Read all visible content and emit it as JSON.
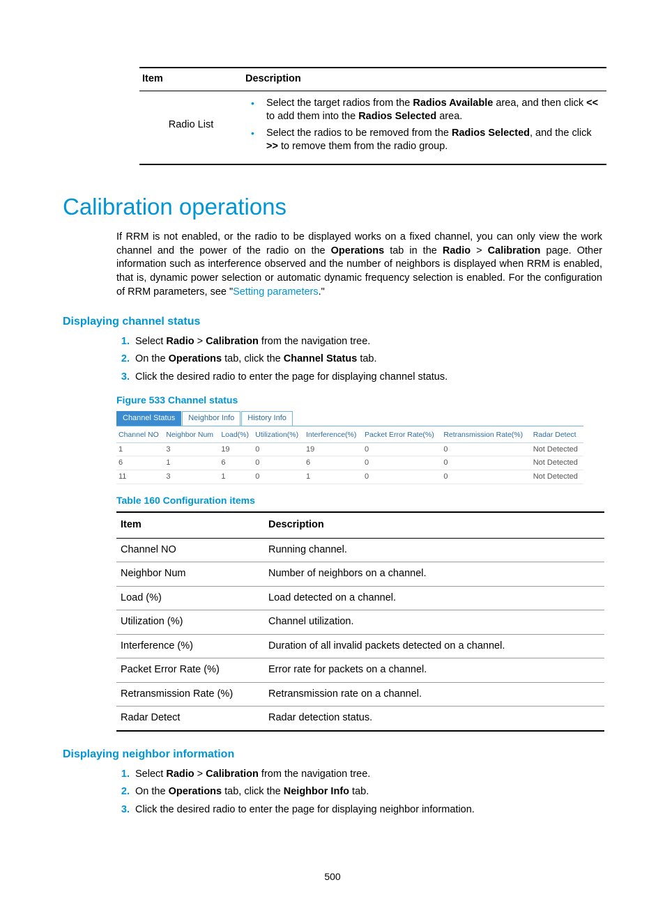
{
  "top_table": {
    "headers": {
      "item": "Item",
      "desc": "Description"
    },
    "row": {
      "item": "Radio List",
      "bullet1_pre": "Select the target radios from the ",
      "bullet1_b1": "Radios Available",
      "bullet1_mid": " area, and then click ",
      "bullet1_b2": "<<",
      "bullet1_post": " to add them into the ",
      "bullet1_b3": "Radios Selected",
      "bullet1_end": " area.",
      "bullet2_pre": "Select the radios to be removed from the ",
      "bullet2_b1": "Radios Selected",
      "bullet2_mid": ", and the click ",
      "bullet2_b2": ">>",
      "bullet2_post": " to remove them from the radio group."
    }
  },
  "section_title": "Calibration operations",
  "intro": {
    "p1a": "If RRM is not enabled, or the radio to be displayed works on a fixed channel, you can only view the work channel and the power of the radio on the ",
    "p1b": "Operations",
    "p1c": " tab in the ",
    "p1d": "Radio",
    "p1e": " > ",
    "p1f": "Calibration",
    "p1g": " page. Other information such as interference observed and the number of neighbors is displayed when RRM is enabled, that is, dynamic power selection or automatic dynamic frequency selection is enabled. For the configuration of RRM parameters, see \"",
    "p1h": "Setting parameters",
    "p1i": ".\""
  },
  "sub1": "Displaying channel status",
  "steps1": {
    "s1a": "Select ",
    "s1b": "Radio",
    "s1c": " > ",
    "s1d": "Calibration",
    "s1e": " from the navigation tree.",
    "s2a": "On the ",
    "s2b": "Operations",
    "s2c": " tab, click the ",
    "s2d": "Channel Status",
    "s2e": " tab.",
    "s3": "Click the desired radio to enter the page for displaying channel status."
  },
  "fig533_caption": "Figure 533 Channel status",
  "tabs": {
    "t1": "Channel Status",
    "t2": "Neighbor Info",
    "t3": "History Info"
  },
  "chart_data": {
    "type": "table",
    "columns": [
      "Channel NO",
      "Neighbor Num",
      "Load(%)",
      "Utilization(%)",
      "Interference(%)",
      "Packet Error Rate(%)",
      "Retransmission Rate(%)",
      "Radar Detect"
    ],
    "rows": [
      [
        "1",
        "3",
        "19",
        "0",
        "19",
        "0",
        "0",
        "Not Detected"
      ],
      [
        "6",
        "1",
        "6",
        "0",
        "6",
        "0",
        "0",
        "Not Detected"
      ],
      [
        "11",
        "3",
        "1",
        "0",
        "1",
        "0",
        "0",
        "Not Detected"
      ]
    ]
  },
  "tbl160_caption": "Table 160 Configuration items",
  "config_headers": {
    "item": "Item",
    "desc": "Description"
  },
  "config_rows": [
    {
      "item": "Channel NO",
      "desc": "Running channel."
    },
    {
      "item": "Neighbor Num",
      "desc": "Number of neighbors on a channel."
    },
    {
      "item": "Load (%)",
      "desc": "Load detected on a channel."
    },
    {
      "item": "Utilization (%)",
      "desc": "Channel utilization."
    },
    {
      "item": "Interference (%)",
      "desc": "Duration of all invalid packets detected on a channel."
    },
    {
      "item": "Packet Error Rate (%)",
      "desc": "Error rate for packets on a channel."
    },
    {
      "item": "Retransmission Rate (%)",
      "desc": "Retransmission rate on a channel."
    },
    {
      "item": "Radar Detect",
      "desc": "Radar detection status."
    }
  ],
  "sub2": "Displaying neighbor information",
  "steps2": {
    "s1a": "Select ",
    "s1b": "Radio",
    "s1c": " > ",
    "s1d": "Calibration",
    "s1e": " from the navigation tree.",
    "s2a": "On the ",
    "s2b": "Operations",
    "s2c": " tab, click the ",
    "s2d": "Neighbor Info",
    "s2e": " tab.",
    "s3": "Click the desired radio to enter the page for displaying neighbor information."
  },
  "page_number": "500"
}
